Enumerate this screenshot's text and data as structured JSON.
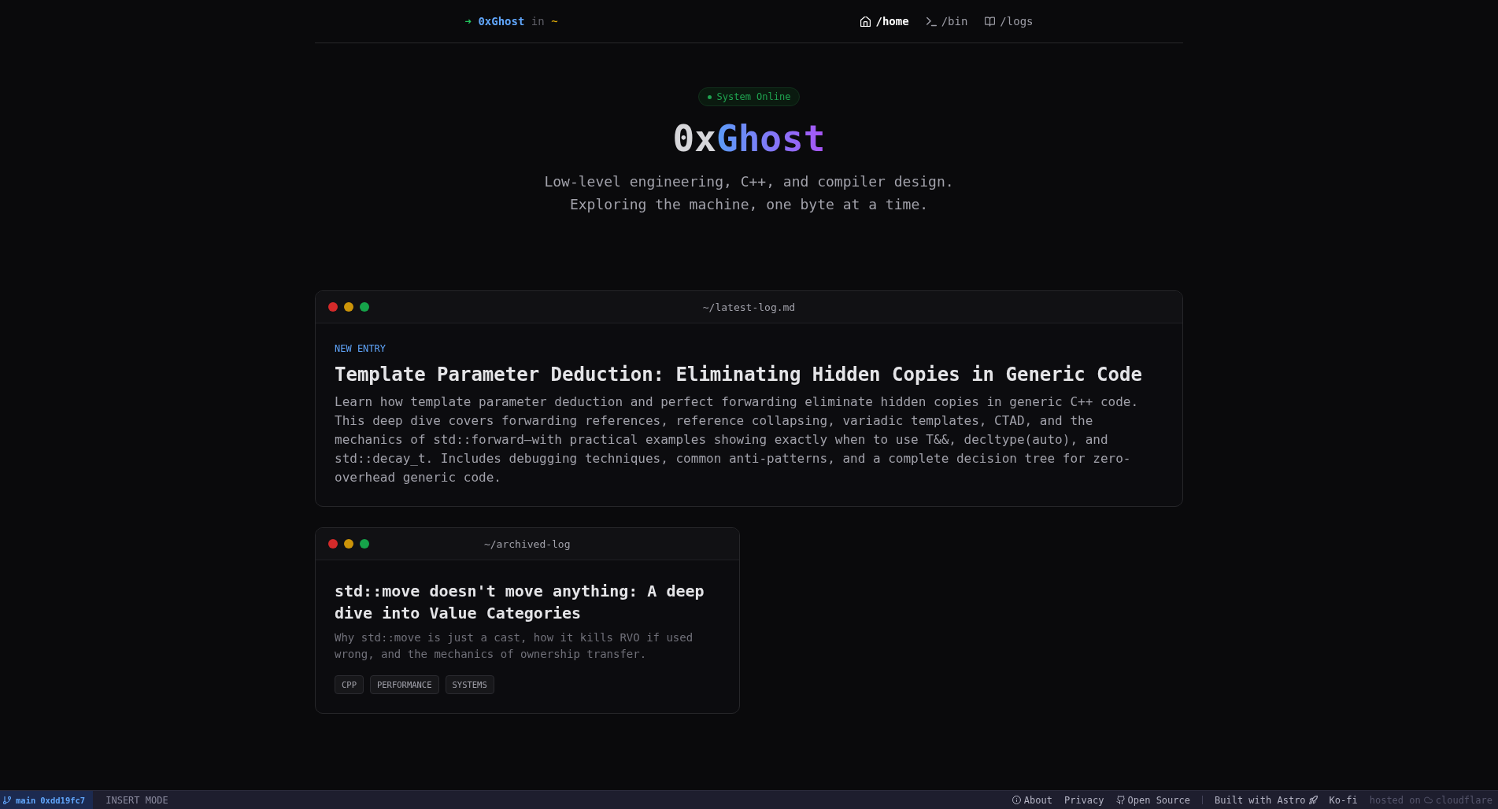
{
  "nav": {
    "prompt": {
      "arrow": "➜",
      "user": "0xGhost",
      "word": "in",
      "path": "~"
    },
    "links": [
      {
        "label": "/home",
        "selected": true
      },
      {
        "label": "/bin",
        "selected": false
      },
      {
        "label": "/logs",
        "selected": false
      }
    ]
  },
  "hero": {
    "badge": "System Online",
    "title": {
      "prefix": "0x",
      "accent": "Ghost"
    },
    "tagline": [
      "Low-level engineering, C++, and compiler design.",
      "Exploring the machine, one byte at a time."
    ]
  },
  "latest_log": {
    "filename": "~/latest-log.md",
    "label": "NEW ENTRY",
    "title": "Template Parameter Deduction: Eliminating Hidden Copies in Generic Code",
    "description": "Learn how template parameter deduction and perfect forwarding eliminate hidden copies in generic C++ code. This deep dive covers forwarding references, reference collapsing, variadic templates, CTAD, and the mechanics of std::forward—with practical examples showing exactly when to use T&&, decltype(auto), and std::decay_t. Includes debugging techniques, common anti-patterns, and a complete decision tree for zero-overhead generic code."
  },
  "archived_logs": [
    {
      "filename": "~/archived-log",
      "title": "std::move doesn't move anything: A deep dive into Value Categories",
      "description": "Why std::move is just a cast, how it kills RVO if used wrong, and the mechanics of ownership transfer.",
      "tags": [
        "CPP",
        "PERFORMANCE",
        "SYSTEMS"
      ]
    }
  ],
  "status_bar": {
    "branch": "main",
    "commit": "0xdd19fc7",
    "mode": "INSERT MODE",
    "links": [
      "About",
      "Privacy",
      "Open Source",
      "Built with Astro",
      "Ko-fi"
    ],
    "hosted": {
      "label": "hosted on",
      "provider": "cloudflare"
    }
  }
}
